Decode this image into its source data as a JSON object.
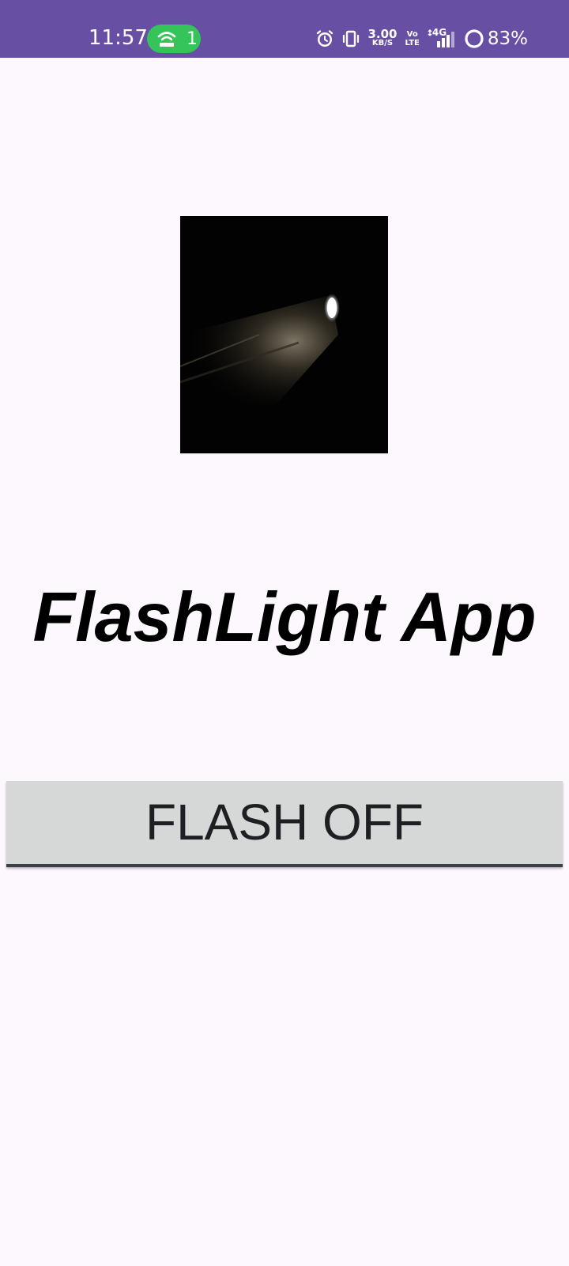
{
  "status_bar": {
    "time": "11:57",
    "hotspot_count": "1",
    "network_speed_value": "3.00",
    "network_speed_unit": "KB/S",
    "volte_top": "Vo",
    "volte_bottom": "LTE",
    "network_type": "4G",
    "battery_level": "83%",
    "background_color": "#6750a4",
    "hotspot_color": "#35c45a",
    "icons": [
      "hotspot-icon",
      "alarm-icon",
      "vibrate-icon",
      "signal-icon",
      "battery-icon"
    ]
  },
  "main": {
    "image_description_icon": "flashlight-image",
    "title": "FlashLight App",
    "button_label": "FLASH OFF"
  }
}
